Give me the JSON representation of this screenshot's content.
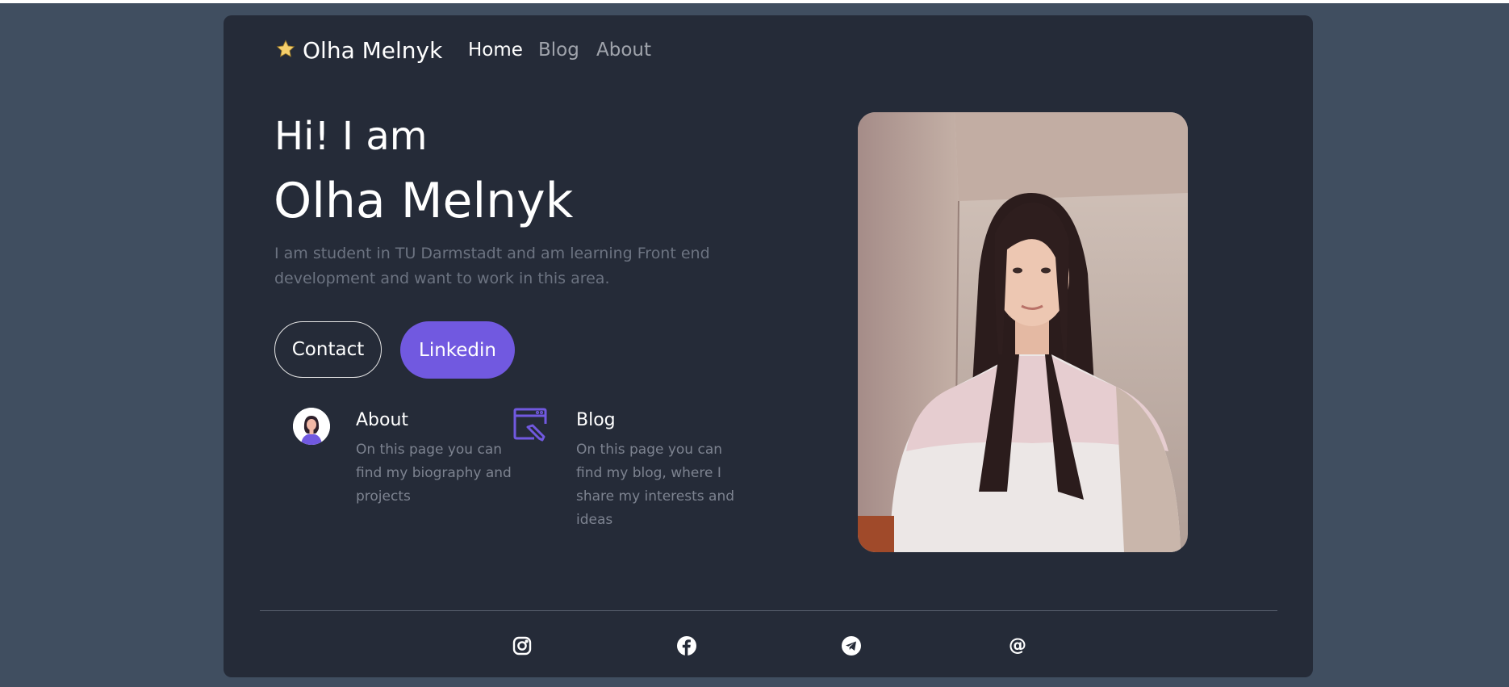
{
  "nav": {
    "brand": "Olha Melnyk",
    "links": [
      "Home",
      "Blog",
      "About"
    ]
  },
  "hero": {
    "greeting": "Hi! I am",
    "name": "Olha Melnyk",
    "intro": "I am student in TU Darmstadt and am learning Front end development and want to work in this area.",
    "contact_label": "Contact",
    "linkedin_label": "Linkedin"
  },
  "features": [
    {
      "title": "About",
      "desc": "On this page you can find my biography and projects"
    },
    {
      "title": "Blog",
      "desc": "On this page you can find my blog, where I share my interests and ideas"
    }
  ],
  "footer": {
    "icons": [
      "instagram-icon",
      "facebook-icon",
      "telegram-icon",
      "email-at-icon"
    ],
    "at_symbol": "@"
  },
  "colors": {
    "page_bg": "#404e60",
    "card_bg": "#252b38",
    "accent": "#7159e0",
    "muted_text": "#6c7381",
    "nav_inactive": "#a0a4ac"
  }
}
